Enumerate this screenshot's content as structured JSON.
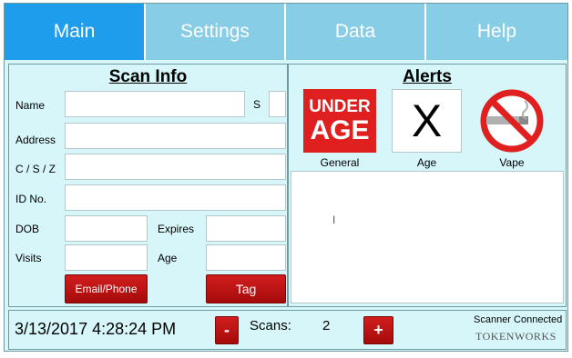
{
  "tabs": [
    {
      "label": "Main",
      "active": true
    },
    {
      "label": "Settings",
      "active": false
    },
    {
      "label": "Data",
      "active": false
    },
    {
      "label": "Help",
      "active": false
    }
  ],
  "scan_info": {
    "title": "Scan Info",
    "labels": {
      "name": "Name",
      "s": "S",
      "address": "Address",
      "csz": "C / S / Z",
      "id_no": "ID No.",
      "dob": "DOB",
      "expires": "Expires",
      "visits": "Visits",
      "age": "Age"
    },
    "email_phone_button": "Email/Phone",
    "tag_button": "Tag"
  },
  "alerts": {
    "title": "Alerts",
    "general_icon_text_top": "UNDER",
    "general_icon_text_bottom": "AGE",
    "general_label": "General",
    "age_icon_text": "X",
    "age_label": "Age",
    "vape_label": "Vape"
  },
  "status": {
    "datetime": "3/13/2017 4:28:24 PM",
    "minus_label": "-",
    "scans_label": "Scans:",
    "scans_count": "2",
    "plus_label": "+",
    "scanner_status": "Scanner Connected",
    "logo_text": "TOKENWORKS"
  },
  "colors": {
    "active_tab": "#1f9ded",
    "inactive_tab": "#88cde6",
    "background": "#d6f6f9",
    "button_red": "#c01414"
  }
}
